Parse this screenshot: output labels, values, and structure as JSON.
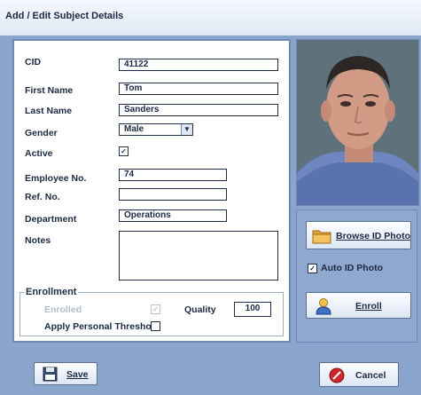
{
  "window": {
    "title": "Add / Edit Subject Details"
  },
  "form": {
    "cid": {
      "label": "CID",
      "value": "41122"
    },
    "first_name": {
      "label": "First Name",
      "value": "Tom"
    },
    "last_name": {
      "label": "Last Name",
      "value": "Sanders"
    },
    "gender": {
      "label": "Gender",
      "value": "Male"
    },
    "active": {
      "label": "Active",
      "checked": true
    },
    "employee_no": {
      "label": "Employee No.",
      "value": "74"
    },
    "ref_no": {
      "label": "Ref. No.",
      "value": ""
    },
    "department": {
      "label": "Department",
      "value": "Operations"
    },
    "notes": {
      "label": "Notes",
      "value": ""
    }
  },
  "enrollment": {
    "legend": "Enrollment",
    "enrolled_label": "Enrolled",
    "enrolled_checked": true,
    "quality_label": "Quality",
    "quality_value": "100",
    "threshold_label": "Apply Personal Threshold",
    "threshold_checked": false
  },
  "side": {
    "browse_label": "Browse ID Photo",
    "auto_photo_label": "Auto ID Photo",
    "auto_photo_checked": true,
    "enroll_label": "Enroll"
  },
  "footer": {
    "save_label": "Save",
    "cancel_label": "Cancel"
  },
  "colors": {
    "window_bg": "#8aa5cc",
    "panel_border": "#6e89b4",
    "cancel_icon": "#d0262a",
    "folder_icon": "#e7a53a"
  }
}
